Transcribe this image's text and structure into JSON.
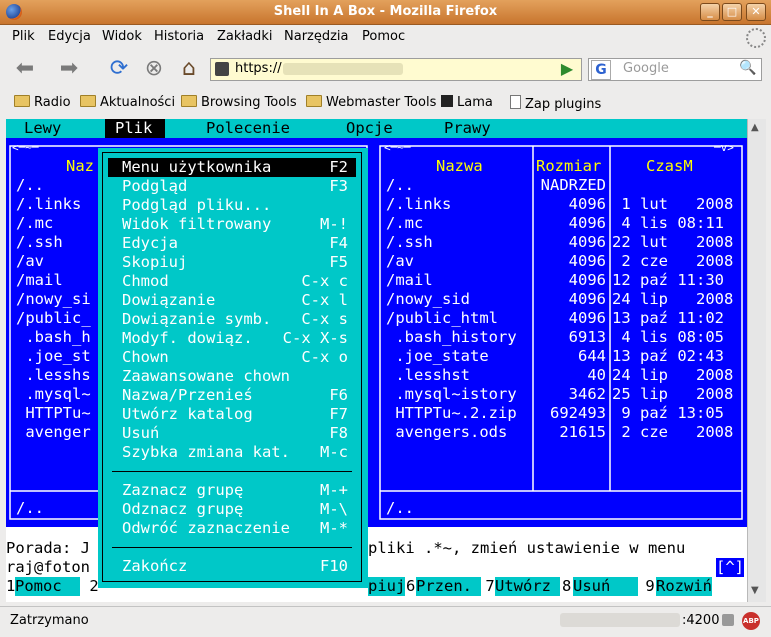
{
  "window": {
    "title": "Shell In A Box - Mozilla Firefox"
  },
  "menubar": {
    "items": [
      "Plik",
      "Edycja",
      "Widok",
      "Historia",
      "Zakładki",
      "Narzędzia",
      "Pomoc"
    ]
  },
  "nav": {
    "url_prefix": "https://",
    "search_placeholder": "Google"
  },
  "bookmarks": [
    {
      "label": "Radio",
      "icon": "folder-icon"
    },
    {
      "label": "Aktualności",
      "icon": "folder-icon"
    },
    {
      "label": "Browsing Tools",
      "icon": "folder-icon"
    },
    {
      "label": "Webmaster Tools",
      "icon": "folder-icon"
    },
    {
      "label": "Lama",
      "icon": "lama-icon"
    },
    {
      "label": "Zap plugins",
      "icon": "page-icon"
    }
  ],
  "status": {
    "text": "Zatrzymano",
    "port": ":4200"
  },
  "colors": {
    "mc_blue": "#0000ff",
    "mc_cyan": "#00c8c8",
    "titlebar": "#d48a44"
  },
  "terminal": {
    "top_menu": [
      "Lewy",
      "Plik",
      "Polecenie",
      "Opcje",
      "Prawy"
    ],
    "top_menu_selected": "Plik",
    "left_panel": {
      "header_visible": "Naz",
      "rows": [
        "/..",
        "/.links",
        "/.mc",
        "/.ssh",
        "/av",
        "/mail",
        "/nowy_si",
        "/public_",
        " .bash_h",
        " .joe_st",
        " .lesshs",
        " .mysql~",
        " HTTPTu~",
        " avenger"
      ],
      "footer": "/.."
    },
    "right_panel": {
      "headers": [
        "Nazwa",
        "Rozmiar",
        "CzasM"
      ],
      "rows": [
        {
          "name": "/..",
          "size": "NADRZED",
          "time": ""
        },
        {
          "name": "/.links",
          "size": "4096",
          "time": " 1 lut   2008"
        },
        {
          "name": "/.mc",
          "size": "4096",
          "time": " 4 lis 08:11"
        },
        {
          "name": "/.ssh",
          "size": "4096",
          "time": "22 lut   2008"
        },
        {
          "name": "/av",
          "size": "4096",
          "time": " 2 cze   2008"
        },
        {
          "name": "/mail",
          "size": "4096",
          "time": "12 paź 11:30"
        },
        {
          "name": "/nowy_sid",
          "size": "4096",
          "time": "24 lip   2008"
        },
        {
          "name": "/public_html",
          "size": "4096",
          "time": "13 paź 11:02"
        },
        {
          "name": " .bash_history",
          "size": "6913",
          "time": " 4 lis 08:05"
        },
        {
          "name": " .joe_state",
          "size": "644",
          "time": "13 paź 02:43"
        },
        {
          "name": " .lesshst",
          "size": "40",
          "time": "24 lip   2008"
        },
        {
          "name": " .mysql~istory",
          "size": "3462",
          "time": "25 lip   2008"
        },
        {
          "name": " HTTPTu~.2.zip",
          "size": "692493",
          "time": " 9 paź 13:05"
        },
        {
          "name": " avengers.ods",
          "size": "21615",
          "time": " 2 cze   2008"
        }
      ],
      "footer": "/.."
    },
    "dropdown": {
      "items": [
        {
          "label": "Menu użytkownika",
          "key": "F2"
        },
        {
          "label": "Podgląd",
          "key": "F3"
        },
        {
          "label": "Podgląd pliku...",
          "key": ""
        },
        {
          "label": "Widok filtrowany",
          "key": "M-!"
        },
        {
          "label": "Edycja",
          "key": "F4"
        },
        {
          "label": "Skopiuj",
          "key": "F5"
        },
        {
          "label": "Chmod",
          "key": "C-x c"
        },
        {
          "label": "Dowiązanie",
          "key": "C-x l"
        },
        {
          "label": "Dowiązanie symb.",
          "key": "C-x s"
        },
        {
          "label": "Modyf. dowiąz.",
          "key": "C-x X-s"
        },
        {
          "label": "Chown",
          "key": "C-x o"
        },
        {
          "label": "Zaawansowane chown",
          "key": ""
        },
        {
          "label": "Nazwa/Przenieś",
          "key": "F6"
        },
        {
          "label": "Utwórz katalog",
          "key": "F7"
        },
        {
          "label": "Usuń",
          "key": "F8"
        },
        {
          "label": "Szybka zmiana kat.",
          "key": "M-c"
        },
        {
          "label": "---",
          "key": ""
        },
        {
          "label": "Zaznacz grupę",
          "key": "M-+"
        },
        {
          "label": "Odznacz grupę",
          "key": "M-\\"
        },
        {
          "label": "Odwróć zaznaczenie",
          "key": "M-*"
        },
        {
          "label": "---",
          "key": ""
        },
        {
          "label": "Zakończ",
          "key": "F10"
        }
      ]
    },
    "hint_line": {
      "left": "Porada: J",
      "right": "pliki .*~, zmień ustawienie w menu"
    },
    "prompt_line": {
      "left": "raj@foton",
      "right": "[^]"
    },
    "function_keys": [
      {
        "num": "1",
        "label": "Pomoc  "
      },
      {
        "num": " 2",
        "label": ""
      },
      {
        "num": "",
        "label": "piuj"
      },
      {
        "num": "6",
        "label": "Przen. "
      },
      {
        "num": " 7",
        "label": "Utwórz "
      },
      {
        "num": "8",
        "label": "Usuń   "
      },
      {
        "num": " 9",
        "label": "Rozwiń"
      }
    ]
  }
}
